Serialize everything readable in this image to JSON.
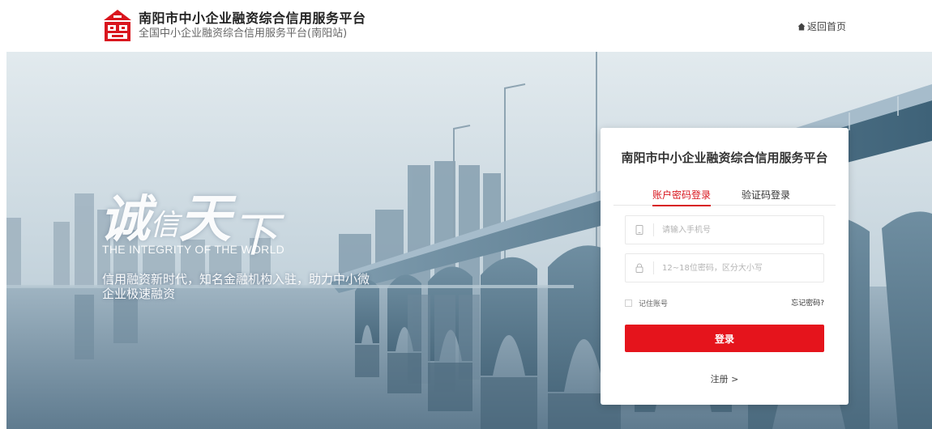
{
  "header": {
    "brand_title": "南阳市中小企业融资综合信用服务平台",
    "brand_subtitle": "全国中小企业融资综合信用服务平台(南阳站)",
    "home_link": "返回首页",
    "logo_icon": "building-seal-icon",
    "home_icon": "home-icon"
  },
  "banner": {
    "slogan_chars": [
      "诚",
      "信",
      "天",
      "下"
    ],
    "slogan_en": "THE INTEGRITY OF THE WORLD",
    "slogan_desc": "信用融资新时代，知名金融机构入驻，助力中小微企业极速融资"
  },
  "login": {
    "title": "南阳市中小企业融资综合信用服务平台",
    "tabs": [
      {
        "label": "账户密码登录",
        "active": true
      },
      {
        "label": "验证码登录",
        "active": false
      }
    ],
    "phone_placeholder": "请输入手机号",
    "password_placeholder": "12~18位密码，区分大小写",
    "remember_label": "记住账号",
    "forgot_label": "忘记密码?",
    "login_button": "登录",
    "register_link": "注册 >",
    "phone_icon": "phone-icon",
    "lock_icon": "lock-icon"
  },
  "colors": {
    "accent": "#e5141c",
    "tab_active": "#d8151d",
    "sky": "#d7e3ea",
    "water": "#7f97a8"
  }
}
